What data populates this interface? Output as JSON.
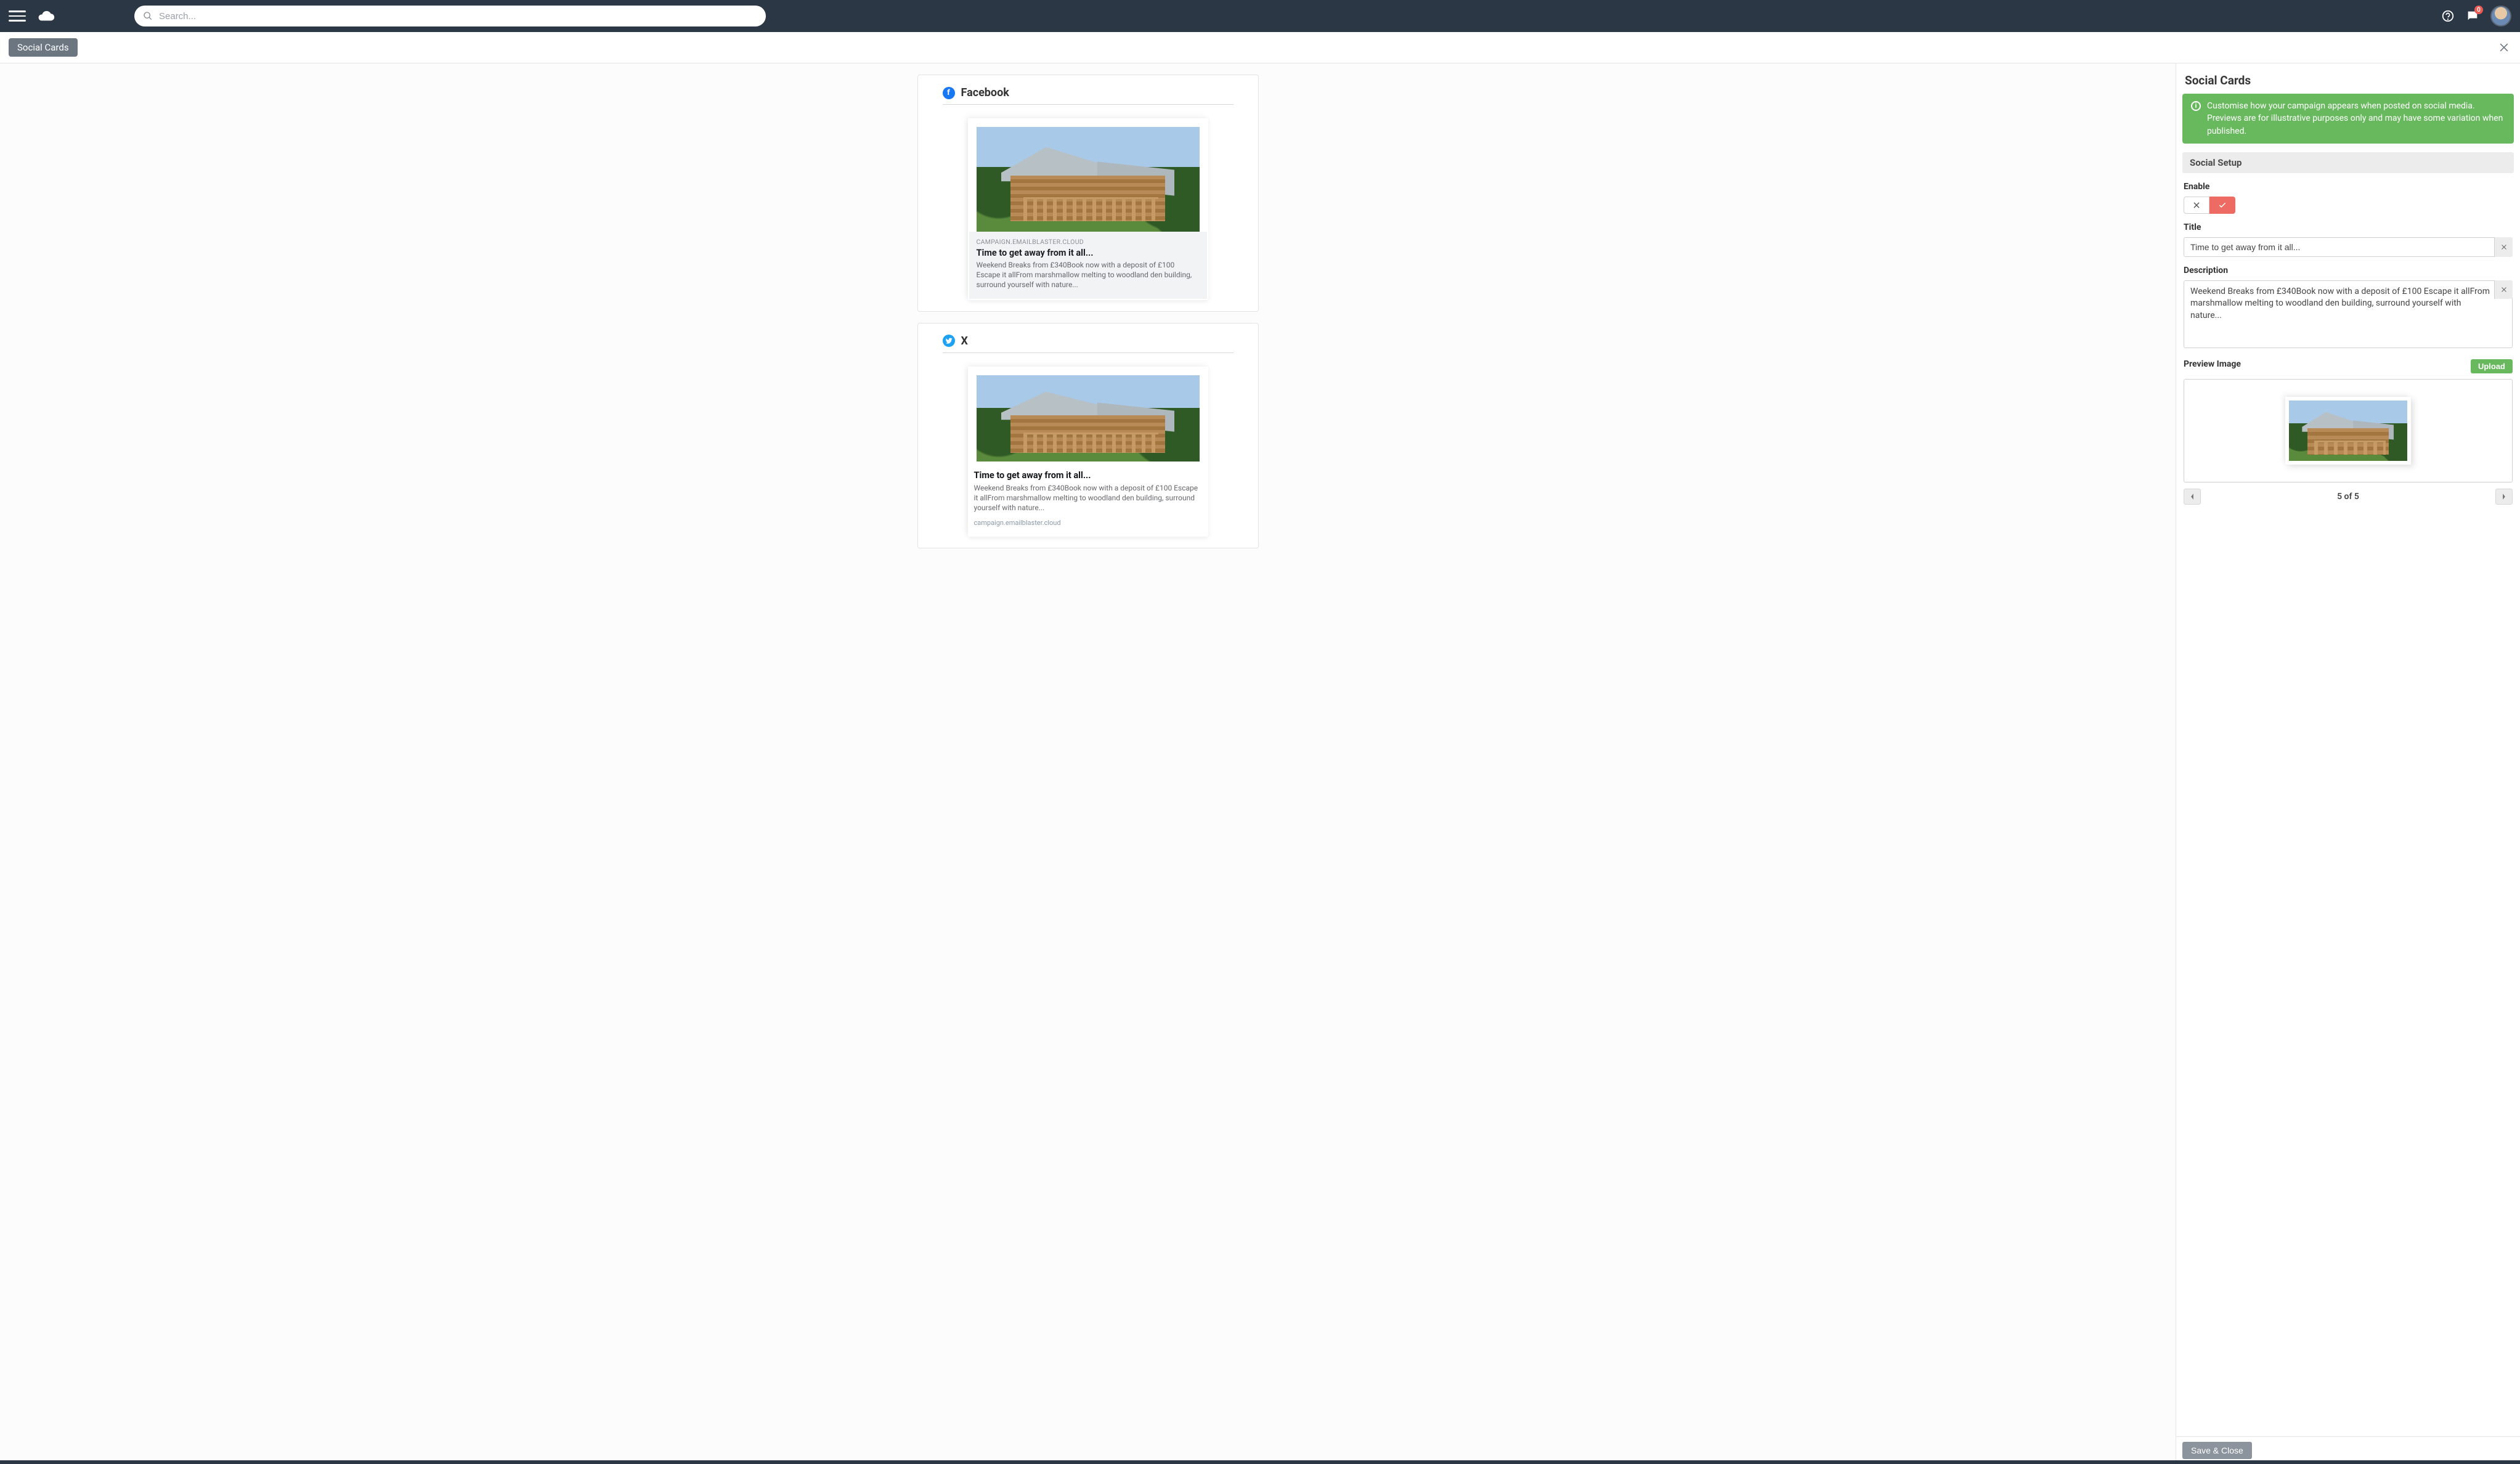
{
  "topbar": {
    "search_placeholder": "Search...",
    "notifications_count": "0"
  },
  "subheader": {
    "pill_label": "Social Cards"
  },
  "previews": {
    "facebook": {
      "label": "Facebook",
      "domain": "CAMPAIGN.EMAILBLASTER.CLOUD",
      "title": "Time to get away from it all...",
      "description": "Weekend Breaks from £340Book now with a deposit of £100 Escape it allFrom marshmallow melting to woodland den building, surround yourself with nature..."
    },
    "x": {
      "label": "X",
      "title": "Time to get away from it all...",
      "description": "Weekend Breaks from £340Book now with a deposit of £100 Escape it allFrom marshmallow melting to woodland den building, surround yourself with nature...",
      "domain": "campaign.emailblaster.cloud"
    }
  },
  "panel": {
    "heading": "Social Cards",
    "info_text": "Customise how your campaign appears when posted on social media. Previews are for illustrative purposes only and may have some variation when published.",
    "section_label": "Social Setup",
    "enable_label": "Enable",
    "title_label": "Title",
    "title_value": "Time to get away from it all...",
    "description_label": "Description",
    "description_value": "Weekend Breaks from £340Book now with a deposit of £100 Escape it allFrom marshmallow melting to woodland den building, surround yourself with nature...",
    "preview_image_label": "Preview Image",
    "upload_label": "Upload",
    "pager_text": "5 of 5",
    "save_label": "Save & Close"
  }
}
